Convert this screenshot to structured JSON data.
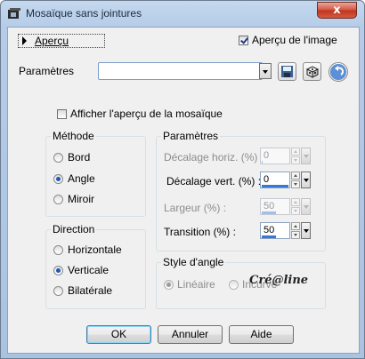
{
  "window": {
    "title": "Mosaïque sans jointures",
    "close_glyph": "x"
  },
  "top": {
    "preview_label": "Aperçu",
    "preview_image_label": "Aperçu de l'image",
    "preview_image_checked": true
  },
  "presets": {
    "label": "Paramètres",
    "value": "",
    "save_icon": "floppy-disk-icon",
    "random_icon": "dice-icon",
    "reset_icon": "undo-arrow-icon"
  },
  "mosaic_preview": {
    "label": "Afficher l'aperçu de la mosaïque",
    "checked": false
  },
  "method": {
    "title": "Méthode",
    "options": [
      "Bord",
      "Angle",
      "Miroir"
    ],
    "selected": "Angle"
  },
  "direction": {
    "title": "Direction",
    "options": [
      "Horizontale",
      "Verticale",
      "Bilatérale"
    ],
    "selected": "Verticale"
  },
  "params": {
    "title": "Paramètres",
    "h_offset": {
      "label": "Décalage horiz. (%) :",
      "value": "0",
      "enabled": false
    },
    "v_offset": {
      "label": "Décalage vert. (%) :",
      "value": "0",
      "enabled": true
    },
    "width": {
      "label": "Largeur (%) :",
      "value": "50",
      "enabled": false
    },
    "transition": {
      "label": "Transition (%) :",
      "value": "50",
      "enabled": true
    }
  },
  "angle_style": {
    "title": "Style d'angle",
    "options": [
      "Linéaire",
      "Incurvé"
    ],
    "selected": "Linéaire",
    "enabled": false
  },
  "watermark": "Cré@line",
  "buttons": {
    "ok": "OK",
    "cancel": "Annuler",
    "help": "Aide"
  },
  "colors": {
    "title_bar": "#b5cce8",
    "close_button": "#c0341f",
    "accent": "#3578d5"
  }
}
